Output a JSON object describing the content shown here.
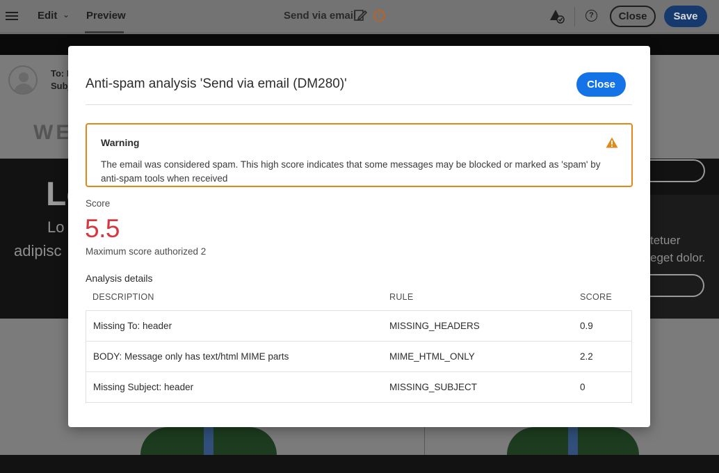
{
  "topbar": {
    "edit_label": "Edit",
    "preview_label": "Preview",
    "doc_title": "Send via email",
    "alert_glyph": "!",
    "help_glyph": "?",
    "close_label": "Close",
    "save_label": "Save",
    "icons": [
      "menu-icon",
      "chevron-down-icon",
      "edit-document-icon",
      "alert-icon",
      "proof-check-icon",
      "help-icon"
    ]
  },
  "background": {
    "to_label": "To: M",
    "subject_label": "Subj",
    "brand_text": "WE",
    "hero_title": "Le",
    "hero_line1": "Lo",
    "hero_line2": "adipisc",
    "right_line1": "tetuer",
    "right_line2": "eget dolor."
  },
  "modal": {
    "title": "Anti-spam analysis 'Send via email (DM280)'",
    "close_label": "Close",
    "warning": {
      "heading": "Warning",
      "text": "The email was considered spam. This high score indicates that some messages may be blocked or marked as 'spam' by anti-spam tools when received",
      "color": "#e68619"
    },
    "score_label": "Score",
    "score_value": "5.5",
    "score_color": "#d7373f",
    "max_score_text": "Maximum score authorized 2",
    "details_label": "Analysis details",
    "columns": [
      "DESCRIPTION",
      "RULE",
      "SCORE"
    ],
    "rows": [
      {
        "description": "Missing To: header",
        "rule": "MISSING_HEADERS",
        "score": "0.9"
      },
      {
        "description": "BODY: Message only has text/html MIME parts",
        "rule": "MIME_HTML_ONLY",
        "score": "2.2"
      },
      {
        "description": "Missing Subject: header",
        "rule": "MISSING_SUBJECT",
        "score": "0"
      }
    ]
  },
  "colors": {
    "accent_blue": "#1473e6",
    "save_button": "#163a6e"
  }
}
